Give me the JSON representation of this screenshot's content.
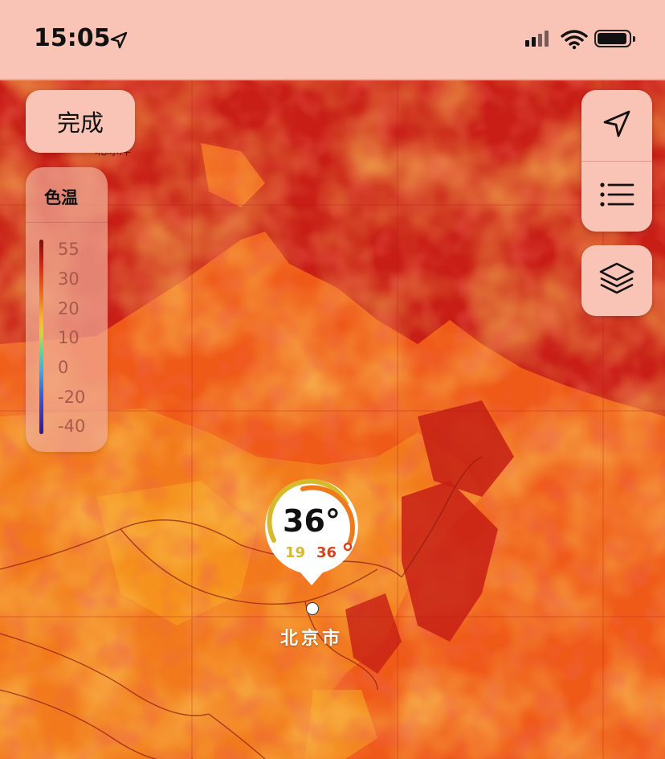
{
  "status_bar": {
    "time": "15:05",
    "location_icon": "location-arrow-icon",
    "signal_icon": "cellular-signal-icon",
    "wifi_icon": "wifi-icon",
    "battery_icon": "battery-icon"
  },
  "map": {
    "layer": "temperature",
    "ocean_label": "北冰洋",
    "colors": {
      "deep_red": "#c81e16",
      "orange": "#f26a1a",
      "amber": "#f29a1c",
      "panel": "#f9c4b6"
    }
  },
  "controls": {
    "done_label": "完成",
    "navigate_icon": "navigation-arrow-icon",
    "list_icon": "list-icon",
    "layers_icon": "layers-icon"
  },
  "legend": {
    "title": "色温",
    "labels": [
      "55",
      "30",
      "20",
      "10",
      "0",
      "-20",
      "-40"
    ]
  },
  "location_pin": {
    "current_temp": "36°",
    "low": "19",
    "high": "36",
    "city": "北京市"
  }
}
